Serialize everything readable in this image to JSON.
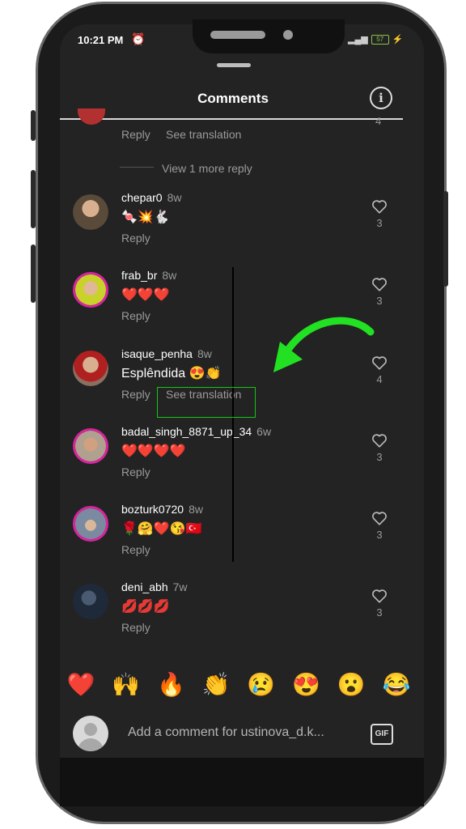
{
  "status": {
    "time": "10:21 PM",
    "battery": "57"
  },
  "header": {
    "title": "Comments",
    "info_icon": "info-icon"
  },
  "prev_thread": {
    "reply": "Reply",
    "see_translation": "See translation",
    "like_count": "4",
    "view_more": "View 1 more reply"
  },
  "comments": [
    {
      "username": "chepar0",
      "age": "8w",
      "text": "🍬💥🐇",
      "reply": "Reply",
      "likes": "3",
      "ring": false,
      "avatar_color": "#5a4a3a"
    },
    {
      "username": "frab_br",
      "age": "8w",
      "text": "❤️❤️❤️",
      "reply": "Reply",
      "likes": "3",
      "ring": true,
      "avatar_color": "#c8d22a"
    },
    {
      "username": "isaque_penha",
      "age": "8w",
      "text": "Esplêndida 😍👏",
      "reply": "Reply",
      "see_translation": "See translation",
      "likes": "4",
      "ring": false,
      "avatar_color": "#8a7060"
    },
    {
      "username": "badal_singh_8871_up_34",
      "age": "6w",
      "text": "❤️❤️❤️❤️",
      "reply": "Reply",
      "likes": "3",
      "ring": true,
      "avatar_color": "#b0a090"
    },
    {
      "username": "bozturk0720",
      "age": "8w",
      "text": "🌹🤗❤️😘🇹🇷",
      "reply": "Reply",
      "likes": "3",
      "ring": true,
      "avatar_color": "#7a8aa0"
    },
    {
      "username": "deni_abh",
      "age": "7w",
      "text": "💋💋💋",
      "reply": "Reply",
      "likes": "3",
      "ring": false,
      "avatar_color": "#1e2a3a"
    }
  ],
  "reactions": [
    "❤️",
    "🙌",
    "🔥",
    "👏",
    "😢",
    "😍",
    "😮",
    "😂"
  ],
  "composer": {
    "placeholder": "Add a comment for ustinova_d.k...",
    "gif_label": "GIF"
  },
  "colors": {
    "background": "#232323",
    "text": "#ffffff",
    "muted": "#9a9a9a",
    "arrow": "#22e022",
    "highlight_box": "#16c716"
  }
}
